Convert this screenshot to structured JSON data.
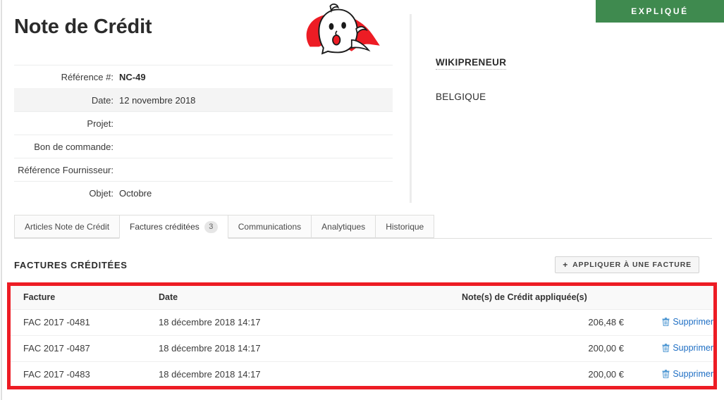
{
  "status": {
    "label": "EXPLIQUÉ",
    "color": "#3f8a4f"
  },
  "document": {
    "title": "Note de Crédit",
    "logo": {
      "icon": "ghost-logo",
      "colors": [
        "#ed1c24",
        "#ffffff"
      ]
    },
    "fields": [
      {
        "label": "Référence #:",
        "value": "NC-49",
        "strong": true
      },
      {
        "label": "Date:",
        "value": "12 novembre 2018",
        "strong": false
      },
      {
        "label": "Projet:",
        "value": "",
        "strong": false
      },
      {
        "label": "Bon de commande:",
        "value": "",
        "strong": false
      },
      {
        "label": "Référence Fournisseur:",
        "value": "",
        "strong": false
      },
      {
        "label": "Objet:",
        "value": "Octobre",
        "strong": false
      }
    ]
  },
  "party": {
    "name": "WIKIPRENEUR",
    "country": "BELGIQUE"
  },
  "tabs": [
    {
      "label": "Articles Note de Crédit",
      "badge": null,
      "active": false
    },
    {
      "label": "Factures créditées",
      "badge": "3",
      "active": true
    },
    {
      "label": "Communications",
      "badge": null,
      "active": false
    },
    {
      "label": "Analytiques",
      "badge": null,
      "active": false
    },
    {
      "label": "Historique",
      "badge": null,
      "active": false
    }
  ],
  "section": {
    "title": "FACTURES CRÉDITÉES",
    "apply_button": {
      "plus": "+",
      "label": "APPLIQUER À UNE FACTURE"
    }
  },
  "table": {
    "highlight_color": "#ed1c24",
    "columns": [
      "Facture",
      "Date",
      "Note(s) de Crédit appliquée(s)",
      ""
    ],
    "rows": [
      {
        "facture": "FAC 2017 -0481",
        "date": "18 décembre 2018 14:17",
        "amount": "206,48 €",
        "action": "Supprimer"
      },
      {
        "facture": "FAC 2017 -0487",
        "date": "18 décembre 2018 14:17",
        "amount": "200,00 €",
        "action": "Supprimer"
      },
      {
        "facture": "FAC 2017 -0483",
        "date": "18 décembre 2018 14:17",
        "amount": "200,00 €",
        "action": "Supprimer"
      }
    ]
  }
}
